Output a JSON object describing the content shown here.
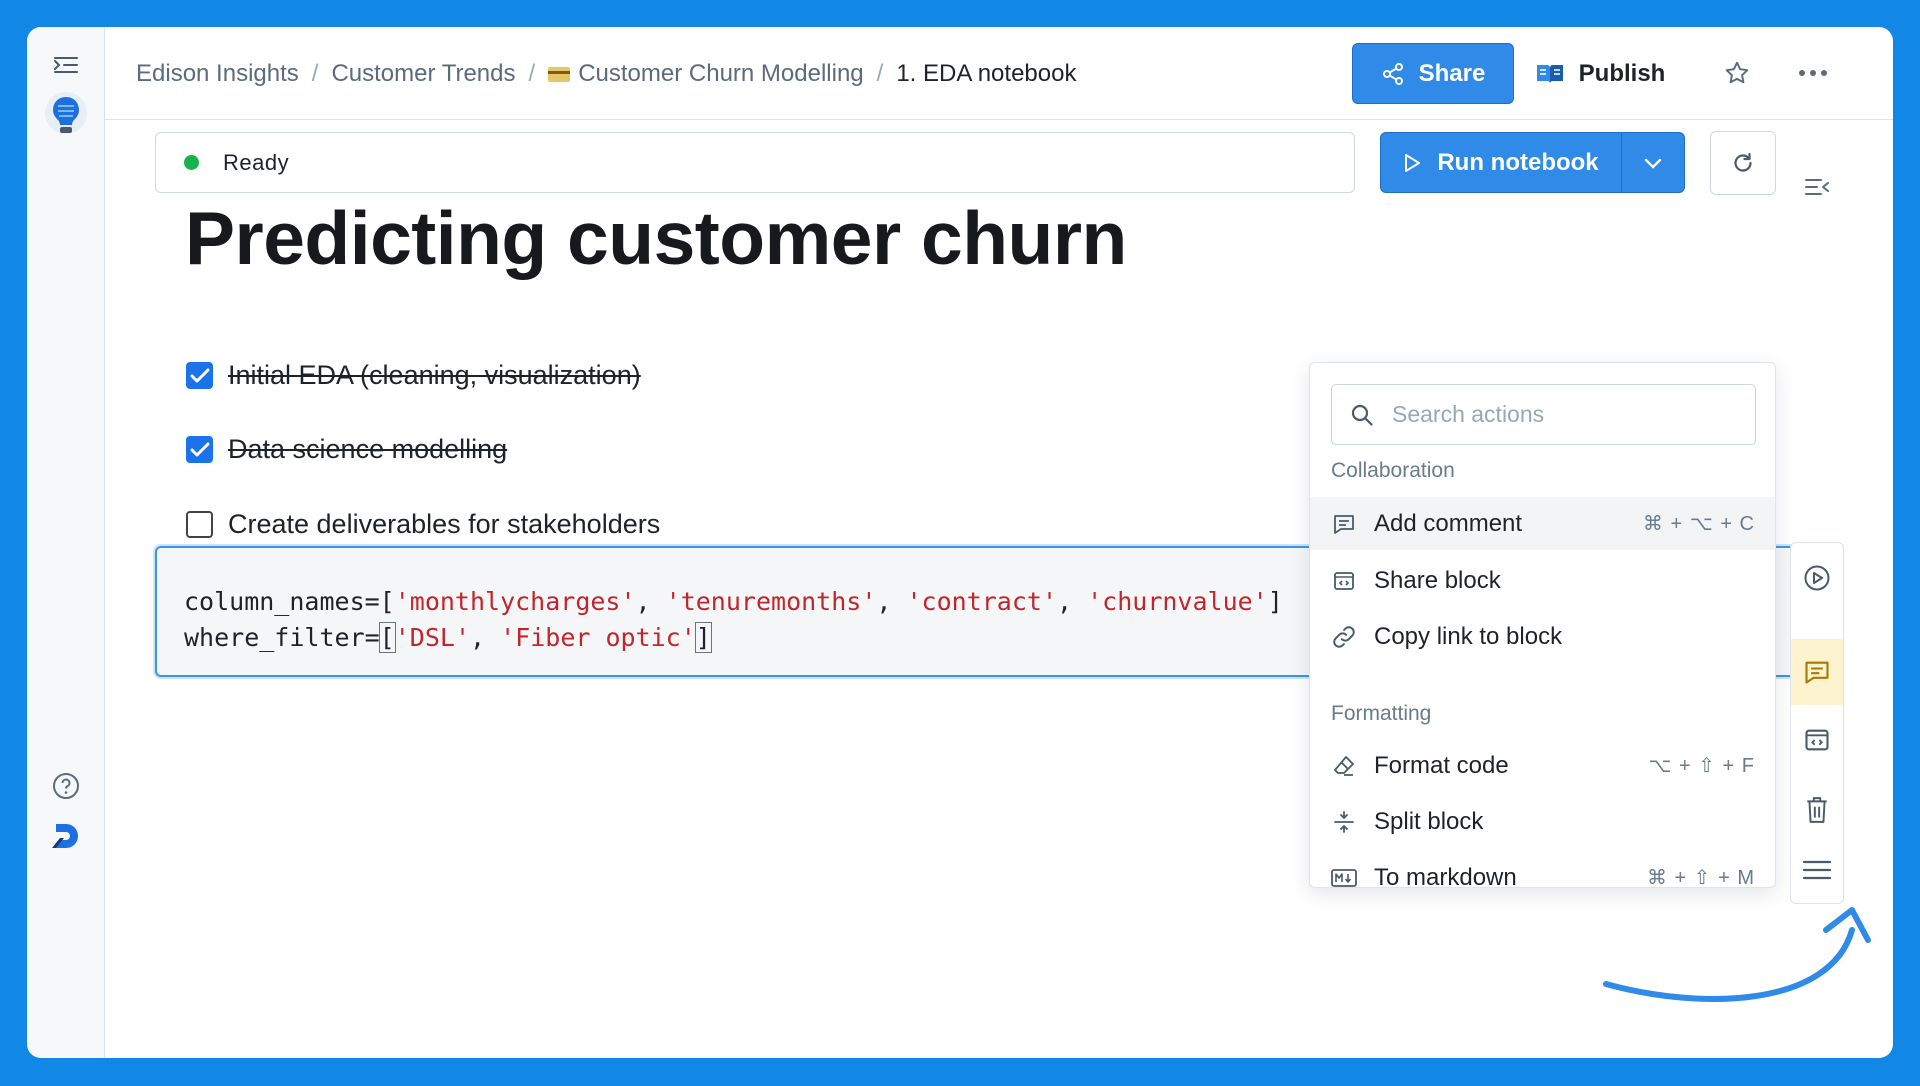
{
  "breadcrumb": {
    "items": [
      "Edison Insights",
      "Customer Trends",
      "Customer Churn Modelling"
    ],
    "current": "1. EDA notebook",
    "separator": "/"
  },
  "header": {
    "share_label": "Share",
    "publish_label": "Publish"
  },
  "status": {
    "text": "Ready",
    "color": "#15b34b"
  },
  "run": {
    "label": "Run notebook"
  },
  "notebook": {
    "title": "Predicting customer churn",
    "todos": [
      {
        "label": "Initial EDA (cleaning, visualization)",
        "checked": true
      },
      {
        "label": "Data science modelling",
        "checked": true
      },
      {
        "label": "Create deliverables for stakeholders",
        "checked": false
      }
    ],
    "code": {
      "line1_var": "column_names=[",
      "line1_strings": [
        "'monthlycharges'",
        "'tenuremonths'",
        "'contract'",
        "'churnvalue'"
      ],
      "line1_end": "]",
      "line2_var": "where_filter=",
      "line2_strings": [
        "'DSL'",
        "'Fiber optic'"
      ]
    }
  },
  "menu": {
    "search_placeholder": "Search actions",
    "sections": [
      {
        "title": "Collaboration",
        "items": [
          {
            "label": "Add comment",
            "shortcut": "⌘ + ⌥ + C",
            "icon": "comment-icon"
          },
          {
            "label": "Share block",
            "shortcut": "",
            "icon": "share-block-icon"
          },
          {
            "label": "Copy link to block",
            "shortcut": "",
            "icon": "link-icon"
          }
        ]
      },
      {
        "title": "Formatting",
        "items": [
          {
            "label": "Format code",
            "shortcut": "⌥ + ⇧ + F",
            "icon": "eraser-icon"
          },
          {
            "label": "Split block",
            "shortcut": "",
            "icon": "split-icon"
          },
          {
            "label": "To markdown",
            "shortcut": "⌘ + ⇧ + M",
            "icon": "markdown-icon"
          }
        ]
      }
    ]
  },
  "colors": {
    "accent": "#2f8ae8",
    "background": "#1188e6",
    "string": "#c0262b",
    "arrow": "#2f8ae8"
  }
}
